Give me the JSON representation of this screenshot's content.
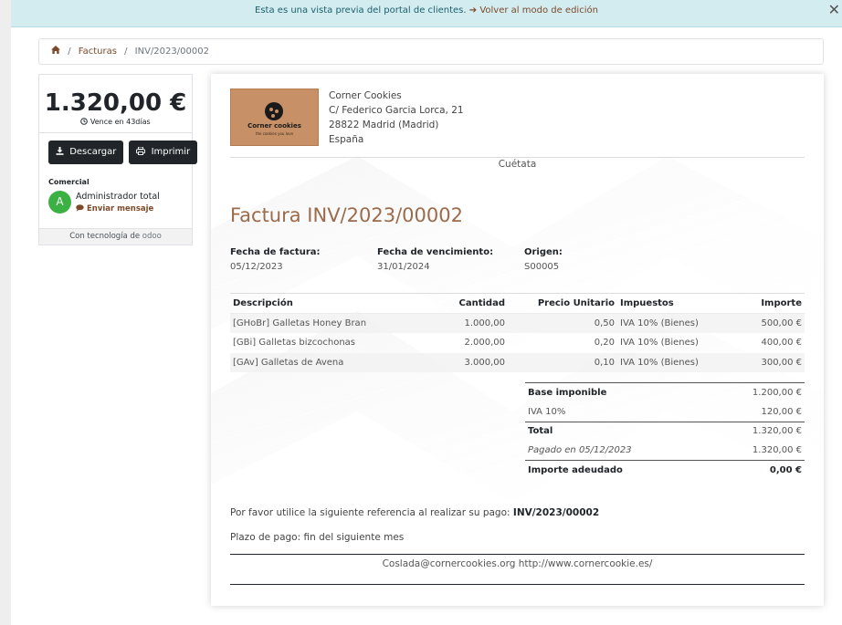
{
  "banner": {
    "text": "Esta es una vista previa del portal de clientes.",
    "link_arrow": "➔",
    "link": "Volver al modo de edición",
    "close": "✕"
  },
  "breadcrumb": {
    "home_icon": "home-icon",
    "items": [
      "Facturas",
      "INV/2023/00002"
    ],
    "separator": "/"
  },
  "sidebar": {
    "amount": "1.320,00 €",
    "due": "Vence en 43días",
    "download": "Descargar",
    "print": "Imprimir",
    "salesperson_title": "Comercial",
    "avatar": "A",
    "salesperson_name": "Administrador total",
    "send_message": "Enviar mensaje",
    "powered_prefix": "Con tecnología de ",
    "powered_brand": "odoo"
  },
  "company": {
    "logo_text": "Corner cookies",
    "logo_sub": "the cookies you love",
    "name": "Corner Cookies",
    "street": "C/ Federico Garcia Lorca, 21",
    "city": "28822 Madrid (Madrid)",
    "country": "España",
    "tagline": "Cuétata"
  },
  "invoice": {
    "title": "Factura INV/2023/00002",
    "date_label": "Fecha de factura:",
    "date": "05/12/2023",
    "due_label": "Fecha de vencimiento:",
    "due_date": "31/01/2024",
    "origin_label": "Origen:",
    "origin": "S00005"
  },
  "lines": {
    "headers": [
      "Descripción",
      "Cantidad",
      "Precio Unitario",
      "Impuestos",
      "Importe"
    ],
    "rows": [
      [
        "[GHoBr] Galletas Honey Bran",
        "1.000,00",
        "0,50",
        "IVA 10% (Bienes)",
        "500,00 €"
      ],
      [
        "[GBi] Galletas bizcochonas",
        "2.000,00",
        "0,20",
        "IVA 10% (Bienes)",
        "400,00 €"
      ],
      [
        "[GAv] Galletas de Avena",
        "3.000,00",
        "0,10",
        "IVA 10% (Bienes)",
        "300,00 €"
      ]
    ]
  },
  "totals": {
    "rows": [
      {
        "label": "Base imponible",
        "value": "1.200,00 €"
      },
      {
        "label": "IVA 10%",
        "value": "120,00 €"
      },
      {
        "label": "Total",
        "value": "1.320,00 €"
      },
      {
        "label": "Pagado en 05/12/2023",
        "value": "1.320,00 €"
      },
      {
        "label": "Importe adeudado",
        "value": "0,00 €"
      }
    ]
  },
  "payment": {
    "ref_text": "Por favor utilice la siguiente referencia al realizar su pago: ",
    "ref_value": "INV/2023/00002",
    "terms": "Plazo de pago: fin del siguiente mes"
  },
  "footer": {
    "text": "Coslada@cornercookies.org http://www.cornercookie.es/"
  }
}
